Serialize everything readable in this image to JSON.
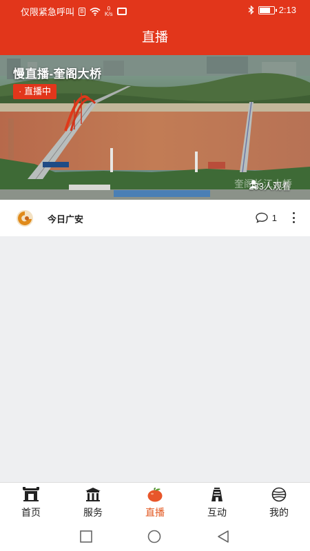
{
  "status_bar": {
    "carrier": "仅限紧急呼叫",
    "sim_label": "B",
    "net_speed_value": "0",
    "net_speed_unit": "K/s",
    "time": "2:13",
    "battery_level": 0.7
  },
  "header": {
    "title": "直播"
  },
  "live": {
    "title": "慢直播-奎阁大桥",
    "badge": "· 直播中",
    "viewers": "283人观看",
    "watermark": "奎阁长江大桥"
  },
  "source": {
    "name": "今日广安",
    "comment_count": "1"
  },
  "tabs": [
    {
      "label": "首页",
      "icon": "home-gate-icon",
      "active": false
    },
    {
      "label": "服务",
      "icon": "service-pavilion-icon",
      "active": false
    },
    {
      "label": "直播",
      "icon": "live-orange-icon",
      "active": true
    },
    {
      "label": "互动",
      "icon": "tower-icon",
      "active": false
    },
    {
      "label": "我的",
      "icon": "profile-globe-icon",
      "active": false
    }
  ],
  "colors": {
    "brand": "#e2361b",
    "active_tab": "#e2561e",
    "background": "#eeeff1"
  }
}
